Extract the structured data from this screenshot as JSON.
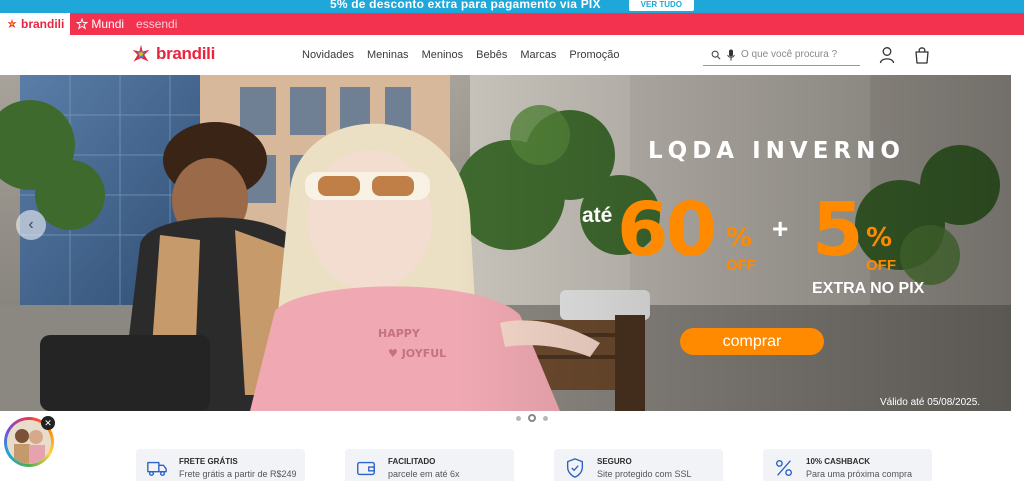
{
  "promo": {
    "text": "5% de desconto extra para pagamento via PIX",
    "button": "VER TUDO"
  },
  "brand_tabs": [
    {
      "label": "brandili"
    },
    {
      "label": "Mundi"
    },
    {
      "label": "essendi"
    }
  ],
  "header": {
    "logo": "brandili",
    "nav": [
      "Novidades",
      "Meninas",
      "Meninos",
      "Bebês",
      "Marcas",
      "Promoção"
    ],
    "search_placeholder": "O que você procura ?"
  },
  "hero": {
    "campaign": "LQDA INVERNO",
    "prefix": "até",
    "discount_main": "60",
    "discount_extra": "5",
    "percent_symbol": "%",
    "off_label": "OFF",
    "plus": "+",
    "extra_label": "EXTRA NO PIX",
    "cta": "comprar",
    "valid_until": "Válido até 05/08/2025.",
    "slide_count": 3,
    "active_slide": 2
  },
  "benefits": [
    {
      "title": "FRETE GRÁTIS",
      "subtitle": "Frete grátis a partir de R$249",
      "icon": "truck-icon"
    },
    {
      "title": "FACILITADO",
      "subtitle": "parcele em até 6x",
      "icon": "wallet-icon"
    },
    {
      "title": "SEGURO",
      "subtitle": "Site protegido com SSL",
      "icon": "shield-icon"
    },
    {
      "title": "10% CASHBACK",
      "subtitle": "Para uma próxima compra",
      "icon": "percent-icon"
    }
  ],
  "colors": {
    "promo_blue": "#1ea7d8",
    "brand_red": "#f2324f",
    "accent_orange": "#ff8a00"
  }
}
